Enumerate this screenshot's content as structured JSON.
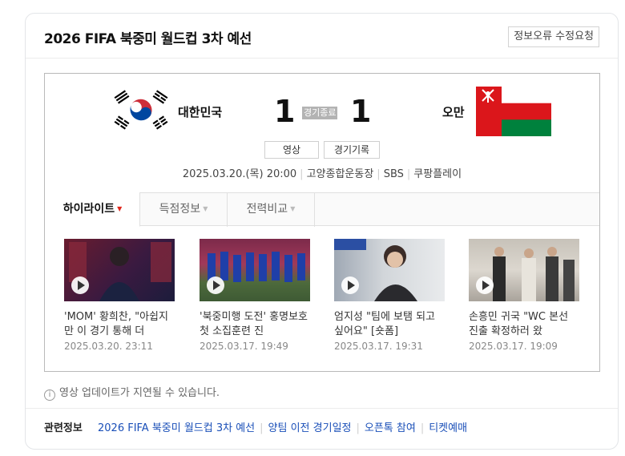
{
  "header": {
    "title": "2026 FIFA 북중미 월드컵 3차 예선",
    "report_button": "정보오류 수정요청"
  },
  "match": {
    "home_team": "대한민국",
    "away_team": "오만",
    "home_score": "1",
    "away_score": "1",
    "status": "경기종료",
    "buttons": {
      "video": "영상",
      "record": "경기기록"
    },
    "info": {
      "datetime": "2025.03.20.(목) 20:00",
      "venue": "고양종합운동장",
      "broadcaster1": "SBS",
      "broadcaster2": "쿠팡플레이"
    },
    "flags": {
      "home": "korea-flag-icon",
      "away": "oman-flag-icon"
    }
  },
  "tabs": [
    {
      "label": "하이라이트",
      "active": true
    },
    {
      "label": "득점정보",
      "active": false
    },
    {
      "label": "전력비교",
      "active": false
    }
  ],
  "videos": [
    {
      "title": "'MOM' 황희찬, \"아쉽지만 이 경기 통해 더",
      "date": "2025.03.20. 23:11"
    },
    {
      "title": "'북중미행 도전' 홍명보호 첫 소집훈련 진",
      "date": "2025.03.17. 19:49"
    },
    {
      "title": "엄지성 \"팀에 보탬 되고 싶어요\" [숏폼]",
      "date": "2025.03.17. 19:31"
    },
    {
      "title": "손흥민 귀국 \"WC 본선 진출 확정하러 왔",
      "date": "2025.03.17. 19:09"
    }
  ],
  "notice": "영상 업데이트가 지연될 수 있습니다.",
  "related": {
    "label": "관련정보",
    "links": [
      "2026 FIFA 북중미 월드컵 3차 예선",
      "양팀 이전 경기일정",
      "오픈톡 참여",
      "티켓예매"
    ]
  },
  "colors": {
    "link": "#1a4fb8",
    "active_caret": "#e0261b",
    "oman_red": "#db161b",
    "oman_green": "#00813d"
  }
}
